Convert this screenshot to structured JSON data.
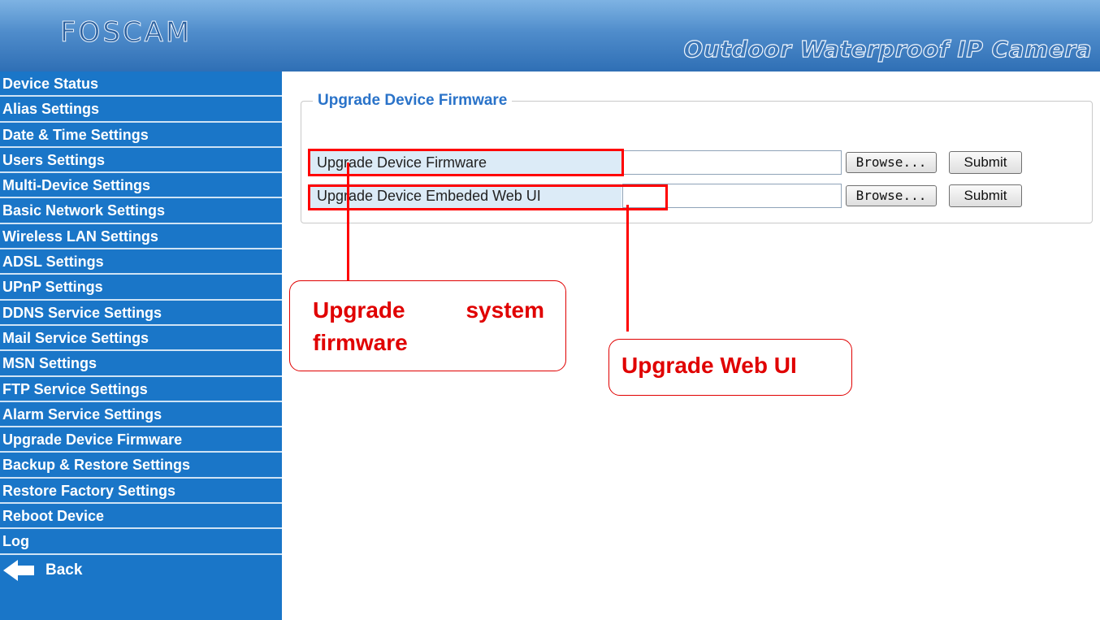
{
  "header": {
    "logo": "FOSCAM",
    "product": "Outdoor Waterproof IP Camera"
  },
  "sidebar": {
    "items": [
      "Device Status",
      "Alias Settings",
      "Date & Time Settings",
      "Users Settings",
      "Multi-Device Settings",
      "Basic Network Settings",
      "Wireless LAN Settings",
      "ADSL Settings",
      "UPnP Settings",
      "DDNS Service Settings",
      "Mail Service Settings",
      "MSN Settings",
      "FTP Service Settings",
      "Alarm Service Settings",
      "Upgrade Device Firmware",
      "Backup & Restore Settings",
      "Restore Factory Settings",
      "Reboot Device",
      "Log"
    ],
    "back_label": "Back",
    "back_icon": "left-arrow-icon"
  },
  "main": {
    "section_title": "Upgrade Device Firmware",
    "rows": [
      {
        "label": "Upgrade Device Firmware",
        "browse_label": "Browse...",
        "submit_label": "Submit",
        "file_value": ""
      },
      {
        "label": "Upgrade Device Embeded Web UI",
        "browse_label": "Browse...",
        "submit_label": "Submit",
        "file_value": ""
      }
    ]
  },
  "annotations": {
    "callout_system_firmware": "Upgrade system firmware",
    "callout_web_ui": "Upgrade Web UI",
    "color": "#ff0000"
  },
  "colors": {
    "sidebar_bg": "#1a76c8",
    "title_blue": "#2a73c9",
    "row_bg": "#dcebf7"
  }
}
